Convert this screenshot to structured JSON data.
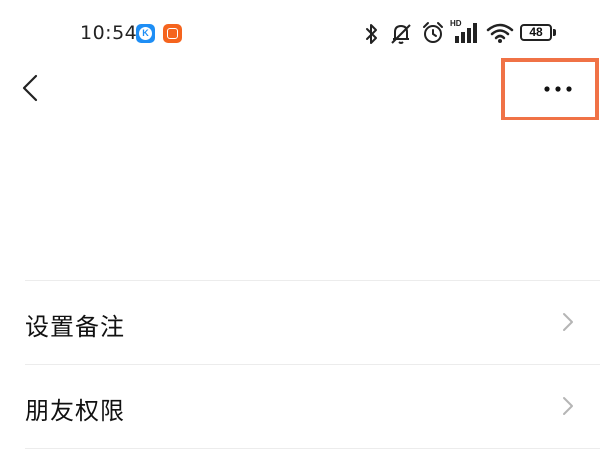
{
  "status_bar": {
    "time": "10:54",
    "app_badges": [
      "k-app-icon",
      "mi-app-icon"
    ],
    "icons": [
      "bluetooth-icon",
      "mute-icon",
      "alarm-icon",
      "signal-icon",
      "wifi-icon"
    ],
    "signal_label": "HD",
    "battery_level": "48"
  },
  "header": {
    "back_icon": "chevron-left-icon",
    "more_icon": "more-horizontal-icon"
  },
  "list": {
    "items": [
      {
        "label": "设置备注",
        "icon": "chevron-right-icon"
      },
      {
        "label": "朋友权限",
        "icon": "chevron-right-icon"
      }
    ]
  },
  "colors": {
    "highlight_border": "#f07246",
    "divider": "#ececec",
    "text": "#111111",
    "chevron": "#b5b5b5"
  }
}
